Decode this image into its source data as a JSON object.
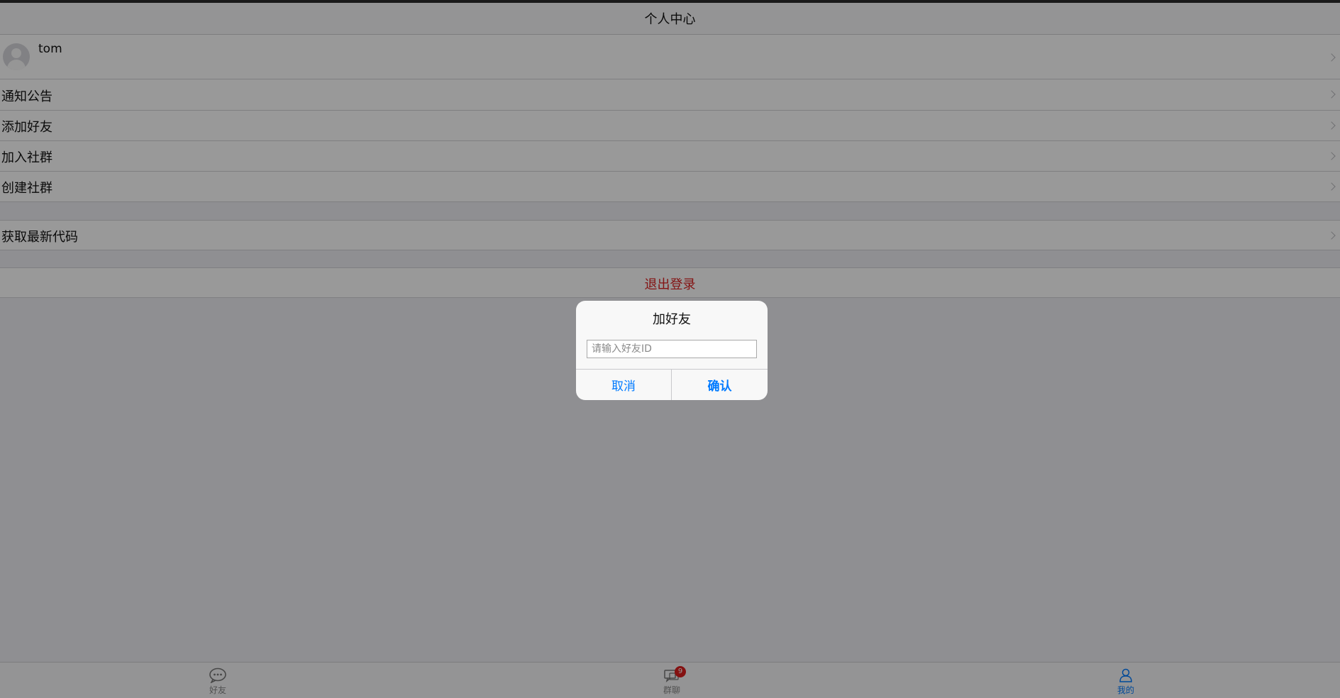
{
  "navbar": {
    "title": "个人中心"
  },
  "profile": {
    "username": "tom"
  },
  "menu": {
    "items": [
      {
        "label": "通知公告"
      },
      {
        "label": "添加好友"
      },
      {
        "label": "加入社群"
      },
      {
        "label": "创建社群"
      }
    ],
    "update_code": {
      "label": "获取最新代码"
    },
    "logout": {
      "label": "退出登录"
    }
  },
  "dialog": {
    "title": "加好友",
    "input": {
      "value": "",
      "placeholder": "请输入好友ID"
    },
    "cancel_label": "取消",
    "confirm_label": "确认"
  },
  "tabbar": {
    "tabs": [
      {
        "label": "好友",
        "icon": "chat-bubble-icon",
        "active": false
      },
      {
        "label": "群聊",
        "icon": "group-chat-icon",
        "active": false,
        "badge": "9"
      },
      {
        "label": "我的",
        "icon": "person-icon",
        "active": true
      }
    ]
  },
  "colors": {
    "accent": "#007aff",
    "danger": "#dd2222",
    "badge": "#dd1d1d",
    "background": "#efeff4"
  }
}
